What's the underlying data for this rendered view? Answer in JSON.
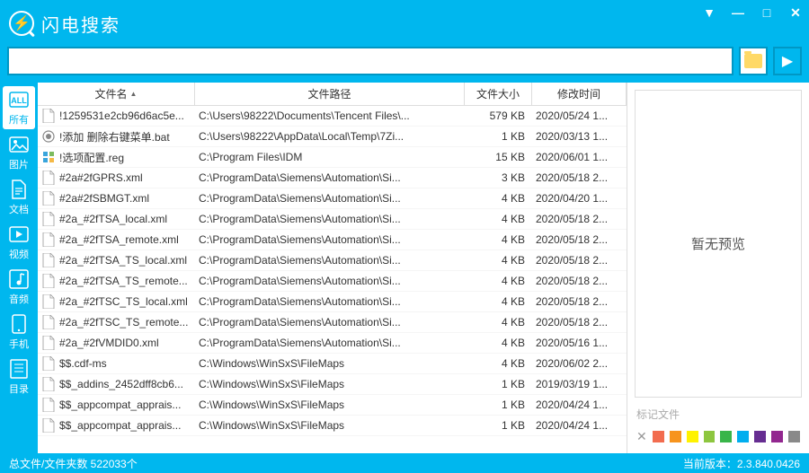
{
  "app": {
    "title": "闪电搜索"
  },
  "search": {
    "placeholder": ""
  },
  "sidebar": {
    "items": [
      {
        "label": "所有"
      },
      {
        "label": "图片"
      },
      {
        "label": "文档"
      },
      {
        "label": "视频"
      },
      {
        "label": "音频"
      },
      {
        "label": "手机"
      },
      {
        "label": "目录"
      }
    ]
  },
  "columns": {
    "name": "文件名",
    "path": "文件路径",
    "size": "文件大小",
    "date": "修改时间"
  },
  "files": [
    {
      "name": "!1259531e2cb96d6ac5e...",
      "path": "C:\\Users\\98222\\Documents\\Tencent Files\\...",
      "size": "579 KB",
      "date": "2020/05/24 1...",
      "ico": "doc"
    },
    {
      "name": "!添加 删除右键菜单.bat",
      "path": "C:\\Users\\98222\\AppData\\Local\\Temp\\7Zi...",
      "size": "1 KB",
      "date": "2020/03/13 1...",
      "ico": "bat"
    },
    {
      "name": "!选项配置.reg",
      "path": "C:\\Program Files\\IDM",
      "size": "15 KB",
      "date": "2020/06/01 1...",
      "ico": "reg"
    },
    {
      "name": "#2a#2fGPRS.xml",
      "path": "C:\\ProgramData\\Siemens\\Automation\\Si...",
      "size": "3 KB",
      "date": "2020/05/18 2...",
      "ico": "doc"
    },
    {
      "name": "#2a#2fSBMGT.xml",
      "path": "C:\\ProgramData\\Siemens\\Automation\\Si...",
      "size": "4 KB",
      "date": "2020/04/20 1...",
      "ico": "doc"
    },
    {
      "name": "#2a_#2fTSA_local.xml",
      "path": "C:\\ProgramData\\Siemens\\Automation\\Si...",
      "size": "4 KB",
      "date": "2020/05/18 2...",
      "ico": "doc"
    },
    {
      "name": "#2a_#2fTSA_remote.xml",
      "path": "C:\\ProgramData\\Siemens\\Automation\\Si...",
      "size": "4 KB",
      "date": "2020/05/18 2...",
      "ico": "doc"
    },
    {
      "name": "#2a_#2fTSA_TS_local.xml",
      "path": "C:\\ProgramData\\Siemens\\Automation\\Si...",
      "size": "4 KB",
      "date": "2020/05/18 2...",
      "ico": "doc"
    },
    {
      "name": "#2a_#2fTSA_TS_remote...",
      "path": "C:\\ProgramData\\Siemens\\Automation\\Si...",
      "size": "4 KB",
      "date": "2020/05/18 2...",
      "ico": "doc"
    },
    {
      "name": "#2a_#2fTSC_TS_local.xml",
      "path": "C:\\ProgramData\\Siemens\\Automation\\Si...",
      "size": "4 KB",
      "date": "2020/05/18 2...",
      "ico": "doc"
    },
    {
      "name": "#2a_#2fTSC_TS_remote...",
      "path": "C:\\ProgramData\\Siemens\\Automation\\Si...",
      "size": "4 KB",
      "date": "2020/05/18 2...",
      "ico": "doc"
    },
    {
      "name": "#2a_#2fVMDID0.xml",
      "path": "C:\\ProgramData\\Siemens\\Automation\\Si...",
      "size": "4 KB",
      "date": "2020/05/16 1...",
      "ico": "doc"
    },
    {
      "name": "$$.cdf-ms",
      "path": "C:\\Windows\\WinSxS\\FileMaps",
      "size": "4 KB",
      "date": "2020/06/02 2...",
      "ico": "doc"
    },
    {
      "name": "$$_addins_2452dff8cb6...",
      "path": "C:\\Windows\\WinSxS\\FileMaps",
      "size": "1 KB",
      "date": "2019/03/19 1...",
      "ico": "doc"
    },
    {
      "name": "$$_appcompat_apprais...",
      "path": "C:\\Windows\\WinSxS\\FileMaps",
      "size": "1 KB",
      "date": "2020/04/24 1...",
      "ico": "doc"
    },
    {
      "name": "$$_appcompat_apprais...",
      "path": "C:\\Windows\\WinSxS\\FileMaps",
      "size": "1 KB",
      "date": "2020/04/24 1...",
      "ico": "doc"
    }
  ],
  "preview": {
    "empty": "暂无预览",
    "tagLabel": "标记文件"
  },
  "tagColors": [
    "#f26c4f",
    "#f7941d",
    "#fff200",
    "#8dc63f",
    "#39b54a",
    "#00aeef",
    "#662d91",
    "#92278f",
    "#898989"
  ],
  "status": {
    "left": "总文件/文件夹数 522033个",
    "rightLabel": "当前版本：",
    "version": "2.3.840.0426"
  }
}
